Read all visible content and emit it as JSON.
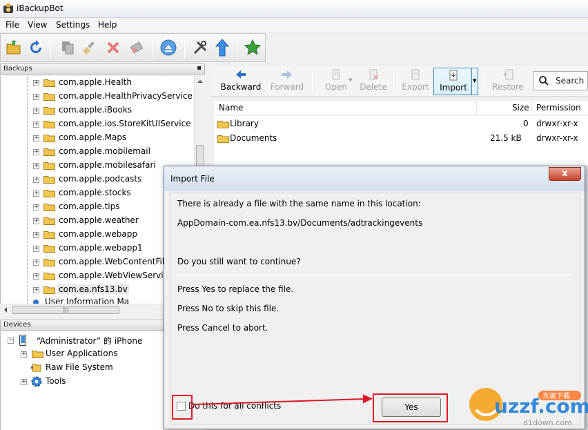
{
  "window": {
    "title": "iBackupBot"
  },
  "menu": [
    "File",
    "View",
    "Settings",
    "Help"
  ],
  "backups_panel": {
    "header": "Backups",
    "items": [
      "com.apple.Health",
      "com.apple.HealthPrivacyService",
      "com.apple.iBooks",
      "com.apple.ios.StoreKitUIService",
      "com.apple.Maps",
      "com.apple.mobilemail",
      "com.apple.mobilesafari",
      "com.apple.podcasts",
      "com.apple.stocks",
      "com.apple.tips",
      "com.apple.weather",
      "com.apple.webapp",
      "com.apple.webapp1",
      "com.apple.WebContentFilter",
      "com.apple.WebViewService",
      "com.ea.nfs13.bv"
    ],
    "partial_item": "User Information Ma"
  },
  "devices_panel": {
    "header": "Devices",
    "device_name": "“Administrator” 的 iPhone",
    "children": [
      "User Applications",
      "Raw File System",
      "Tools"
    ]
  },
  "right_toolbar": {
    "backward": "Backward",
    "forward": "Forward",
    "open": "Open",
    "delete": "Delete",
    "export": "Export",
    "import": "Import",
    "restore": "Restore",
    "search": "Search"
  },
  "file_list": {
    "columns": {
      "name": "Name",
      "size": "Size",
      "permission": "Permission"
    },
    "rows": [
      {
        "name": "Library",
        "size": "0",
        "permission": "drwxr-xr-x"
      },
      {
        "name": "Documents",
        "size": "21.5 kB",
        "permission": "drwxr-xr-x"
      }
    ]
  },
  "dialog": {
    "title": "Import File",
    "close_label": "x",
    "line1": "There is already a file with the same name in this location:",
    "path": "AppDomain-com.ea.nfs13.bv/Documents/adtrackingevents",
    "question": "Do you still want to continue?",
    "yes_hint": "Press Yes to replace the file.",
    "no_hint": "Press No to skip this file.",
    "cancel_hint": "Press Cancel to abort.",
    "checkbox_label": "Do this for all conflicts",
    "yes_button": "Yes"
  },
  "watermark": {
    "brand": "uzzf.com",
    "sub": "d1down.com",
    "tag": "东坡下载"
  },
  "colors": {
    "highlight": "#e0182a",
    "folder": "#f2c64f",
    "selection": "#3c7fb1"
  }
}
